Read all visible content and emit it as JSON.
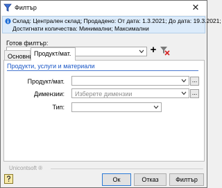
{
  "window": {
    "title": "Филтър",
    "close_label": "✕"
  },
  "info": {
    "line1": "Склад: Централен склад; Продадено: От дата: 1.3.2021; До дата: 19.3.2021;",
    "line2": "Достигнати количества: Минимални; Максимални"
  },
  "ready_filter": {
    "label": "Готов филтър:",
    "value": "",
    "add_label": "+"
  },
  "tabs": [
    {
      "label": "Основни",
      "active": false
    },
    {
      "label": "Продукт/мат.",
      "active": true
    }
  ],
  "section": {
    "title": "Продукти, услуги и материали"
  },
  "fields": {
    "product_label": "Продукт/мат.",
    "product_value": "",
    "dimensions_label": "Димензии:",
    "dimensions_placeholder": "Изберете димензии",
    "type_label": "Тип:",
    "type_value": "",
    "ellipsis": "..."
  },
  "footer": {
    "brand": "Unicontsoft ®",
    "ok": "Ок",
    "cancel": "Отказ",
    "filter": "Филтър"
  },
  "icons": {
    "app": "funnel-icon",
    "info": "info-icon",
    "clear": "clear-filter-icon",
    "help": "help-icon"
  },
  "colors": {
    "info_bg": "#dcebfa",
    "section_title": "#1a57c7",
    "ok_border": "#2a79d6"
  }
}
